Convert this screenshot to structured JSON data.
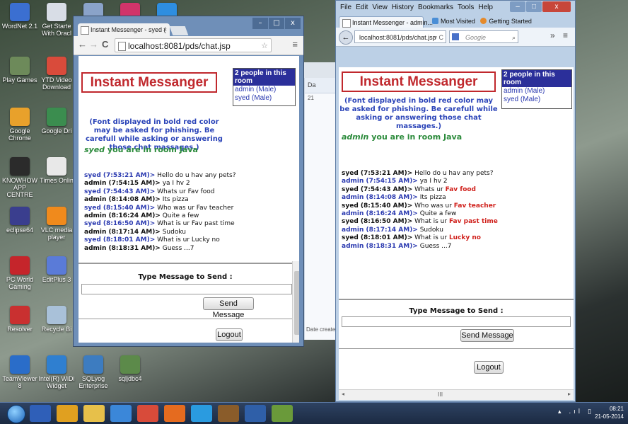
{
  "desktop": {
    "icons": [
      {
        "label": "WordNet 2.1",
        "color": "#3b6fd1"
      },
      {
        "label": "Get Starte With Oracl",
        "color": "#d8dde6"
      },
      {
        "label": "",
        "color": "#8aa3c9"
      },
      {
        "label": "",
        "color": "#d1346a"
      },
      {
        "label": "",
        "color": "#2e8ee0"
      },
      {
        "label": "Play Games",
        "color": "#6d8a5a"
      },
      {
        "label": "YTD Video Download",
        "color": "#d94b3b"
      },
      {
        "label": "Google Chrome",
        "color": "#e8a12b"
      },
      {
        "label": "Google Dri",
        "color": "#3b8d4f"
      },
      {
        "label": "KNOWHOW APP CENTRE",
        "color": "#2b2b2b"
      },
      {
        "label": "Times Onlin",
        "color": "#e8e8e8"
      },
      {
        "label": "eclipse64",
        "color": "#3a3e8e"
      },
      {
        "label": "VLC media player",
        "color": "#f08a1c"
      },
      {
        "label": "PC World Gaming",
        "color": "#c5252b"
      },
      {
        "label": "EditPlus 3",
        "color": "#5a7bd8"
      },
      {
        "label": "Resolver",
        "color": "#c93030"
      },
      {
        "label": "Recycle Bi",
        "color": "#a9c1d9"
      },
      {
        "label": "TeamViewer 8",
        "color": "#2a6dc9"
      },
      {
        "label": "Intel(R) WiDi Widget",
        "color": "#2f7fd0"
      },
      {
        "label": "SQLyog Enterprise",
        "color": "#3d7cc0"
      },
      {
        "label": "sqljdbc4",
        "color": "#5c8a4a"
      }
    ]
  },
  "chrome": {
    "tab_title": "Instant Messenger - syed (",
    "tab_close": "×",
    "url": "localhost:8081/pds/chat.jsp",
    "win_min": "–",
    "win_max": "□",
    "win_close": "x",
    "back": "←",
    "forward": "→",
    "reload": "C",
    "menu": "≡"
  },
  "firefox": {
    "menu": [
      "File",
      "Edit",
      "View",
      "History",
      "Bookmarks",
      "Tools",
      "Help"
    ],
    "win_min": "–",
    "win_max": "□",
    "win_close": "x",
    "tab_title": "Instant Messenger - admin...",
    "bookmarks": [
      "Most Visited",
      "Getting Started"
    ],
    "url": "localhost:8081/pds/chat.jsp",
    "url_tail": "▿ C",
    "search_placeholder": "Google",
    "tools": "» ≡",
    "hscroll": "III"
  },
  "chat_syed": {
    "title": "Instant Messanger",
    "people_header": "2 people in this room",
    "people": [
      {
        "name": "admin",
        "gender": "(Male)"
      },
      {
        "name": "syed",
        "gender": "(Male)"
      }
    ],
    "warning": "(Font displayed in bold red color may be asked for phishing. Be carefull while asking or answering those chat massages.)",
    "room_user": "syed",
    "room_text": "you are in room Java",
    "messages": [
      {
        "who": "syed",
        "time": "syed (7:53:21 AM)>",
        "pre": " Hello do u hav any pets?",
        "hl": "",
        "post": ""
      },
      {
        "who": "admin",
        "time": "admin (7:54:15 AM)>",
        "pre": " ya I hv 2",
        "hl": "",
        "post": ""
      },
      {
        "who": "syed",
        "time": "syed (7:54:43 AM)>",
        "pre": " Whats ur Fav food",
        "hl": "",
        "post": ""
      },
      {
        "who": "admin",
        "time": "admin (8:14:08 AM)>",
        "pre": " Its pizza",
        "hl": "",
        "post": ""
      },
      {
        "who": "syed",
        "time": "syed (8:15:40 AM)>",
        "pre": " Who was ur Fav teacher",
        "hl": "",
        "post": ""
      },
      {
        "who": "admin",
        "time": "admin (8:16:24 AM)>",
        "pre": " Quite a few",
        "hl": "",
        "post": ""
      },
      {
        "who": "syed",
        "time": "syed (8:16:50 AM)>",
        "pre": " What is ur Fav past time",
        "hl": "",
        "post": ""
      },
      {
        "who": "admin",
        "time": "admin (8:17:14 AM)>",
        "pre": " Sudoku",
        "hl": "",
        "post": ""
      },
      {
        "who": "syed",
        "time": "syed (8:18:01 AM)>",
        "pre": " What is ur Lucky no",
        "hl": "",
        "post": ""
      },
      {
        "who": "admin",
        "time": "admin (8:18:31 AM)>",
        "pre": " Guess ...7",
        "hl": "",
        "post": ""
      }
    ],
    "type_label": "Type Message to Send :",
    "send_label": "Send Message",
    "logout_label": "Logout"
  },
  "chat_admin": {
    "title": "Instant Messanger",
    "people_header": "2 people in this room",
    "people": [
      {
        "name": "admin",
        "gender": "(Male)"
      },
      {
        "name": "syed",
        "gender": "(Male)"
      }
    ],
    "warning": "(Font displayed in bold red color may be asked for phishing. Be carefull while asking or answering those chat massages.)",
    "room_user": "admin",
    "room_text": "you are in room Java",
    "messages": [
      {
        "who": "syed",
        "time": "syed (7:53:21 AM)>",
        "pre": " Hello do u hav any pets?",
        "hl": "",
        "post": ""
      },
      {
        "who": "admin",
        "time": "admin (7:54:15 AM)>",
        "pre": " ya I hv 2",
        "hl": "",
        "post": ""
      },
      {
        "who": "syed",
        "time": "syed (7:54:43 AM)>",
        "pre": " Whats ur ",
        "hl": "Fav food",
        "post": ""
      },
      {
        "who": "admin",
        "time": "admin (8:14:08 AM)>",
        "pre": " Its pizza",
        "hl": "",
        "post": ""
      },
      {
        "who": "syed",
        "time": "syed (8:15:40 AM)>",
        "pre": " Who was ur ",
        "hl": "Fav teacher",
        "post": ""
      },
      {
        "who": "admin",
        "time": "admin (8:16:24 AM)>",
        "pre": " Quite a few",
        "hl": "",
        "post": ""
      },
      {
        "who": "syed",
        "time": "syed (8:16:50 AM)>",
        "pre": " What is ur ",
        "hl": "Fav past time",
        "post": ""
      },
      {
        "who": "admin",
        "time": "admin (8:17:14 AM)>",
        "pre": " Sudoku",
        "hl": "",
        "post": ""
      },
      {
        "who": "syed",
        "time": "syed (8:18:01 AM)>",
        "pre": " What is ur ",
        "hl": "Lucky no",
        "post": ""
      },
      {
        "who": "admin",
        "time": "admin (8:18:31 AM)>",
        "pre": " Guess ...7",
        "hl": "",
        "post": ""
      }
    ],
    "type_label": "Type Message to Send :",
    "send_label": "Send Message",
    "logout_label": "Logout"
  },
  "explorer": {
    "header": "Da",
    "cell": "21",
    "footer": "Date created"
  },
  "taskbar": {
    "icons": [
      {
        "name": "media-icon",
        "color": "#2f5fb8"
      },
      {
        "name": "chrome-icon",
        "color": "#e0a020"
      },
      {
        "name": "explorer-icon",
        "color": "#e7c04a"
      },
      {
        "name": "ie-icon",
        "color": "#3b87d9"
      },
      {
        "name": "apps-icon",
        "color": "#d84b3a"
      },
      {
        "name": "firefox-icon",
        "color": "#e56b1f"
      },
      {
        "name": "skype-icon",
        "color": "#2a9be0"
      },
      {
        "name": "settings-icon",
        "color": "#8a5c2a"
      },
      {
        "name": "word-icon",
        "color": "#2f5fa8"
      },
      {
        "name": "paint-icon",
        "color": "#6a9a3a"
      }
    ],
    "clock_time": "08:21",
    "clock_date": "21-05-2014",
    "tray": "▴ .ıl ▯"
  }
}
